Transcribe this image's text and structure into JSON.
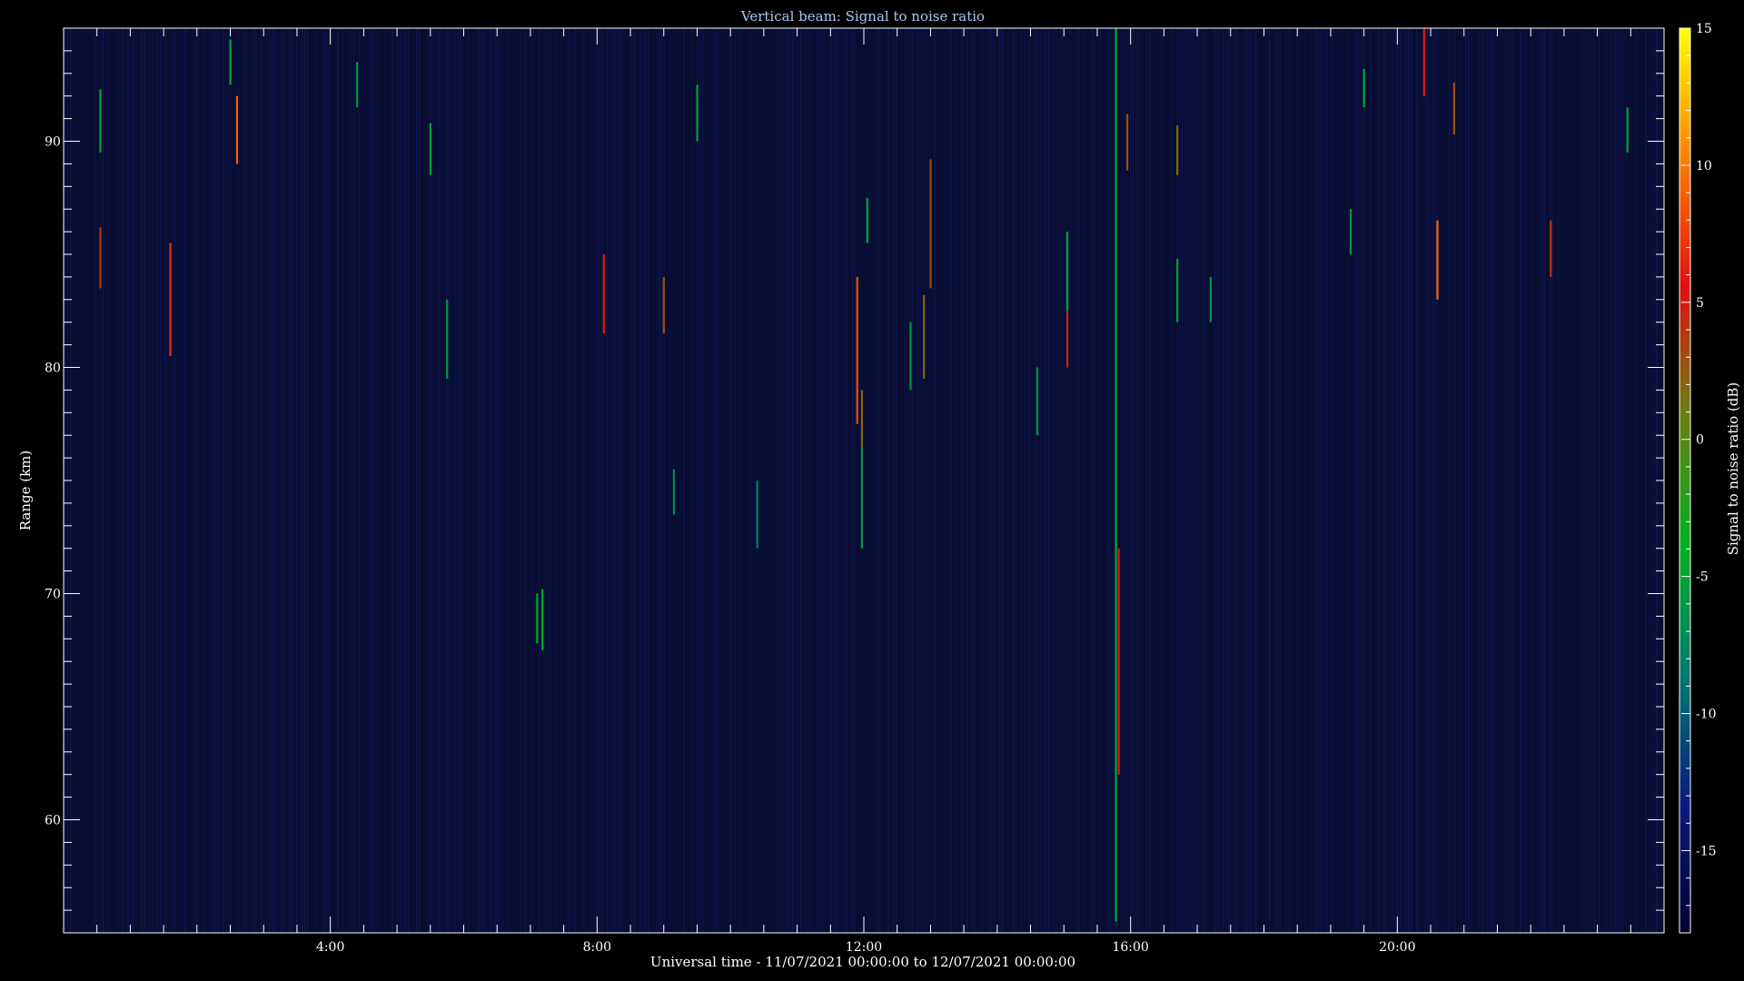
{
  "chart_data": {
    "type": "heatmap",
    "title": "Vertical beam: Signal to noise ratio",
    "xlabel": "Universal time - 11/07/2021 00:00:00 to 12/07/2021 00:00:00",
    "ylabel": "Range (km)",
    "colorbar_label": "Signal to noise ratio (dB)",
    "x_unit": "hours",
    "xlim": [
      0,
      24
    ],
    "ylim": [
      55,
      95
    ],
    "x_ticks": [
      {
        "value": 4,
        "label": "4:00"
      },
      {
        "value": 8,
        "label": "8:00"
      },
      {
        "value": 12,
        "label": "12:00"
      },
      {
        "value": 16,
        "label": "16:00"
      },
      {
        "value": 20,
        "label": "20:00"
      }
    ],
    "y_ticks": [
      {
        "value": 60,
        "label": "60"
      },
      {
        "value": 70,
        "label": "70"
      },
      {
        "value": 80,
        "label": "80"
      },
      {
        "value": 90,
        "label": "90"
      }
    ],
    "colorbar_range": [
      -18,
      15
    ],
    "colorbar_ticks": [
      {
        "value": 15,
        "label": "15"
      },
      {
        "value": 10,
        "label": "10"
      },
      {
        "value": 5,
        "label": "5"
      },
      {
        "value": 0,
        "label": "0"
      },
      {
        "value": -5,
        "label": "-5"
      },
      {
        "value": -10,
        "label": "-10"
      },
      {
        "value": -15,
        "label": "-15"
      }
    ],
    "colormap": [
      "#000030",
      "#0a1a80",
      "#007a70",
      "#00b020",
      "#6a8010",
      "#e01010",
      "#ff8000",
      "#ffff00"
    ],
    "background_color": "#080c30",
    "echoes": [
      {
        "t": 0.55,
        "r0": 83.5,
        "r1": 86.2,
        "snr": 4
      },
      {
        "t": 0.55,
        "r0": 89.5,
        "r1": 92.3,
        "snr": -5
      },
      {
        "t": 1.6,
        "r0": 80.5,
        "r1": 85.5,
        "snr": 7
      },
      {
        "t": 2.5,
        "r0": 92.5,
        "r1": 94.5,
        "snr": -5
      },
      {
        "t": 2.6,
        "r0": 89.0,
        "r1": 92.0,
        "snr": 9
      },
      {
        "t": 4.4,
        "r0": 91.5,
        "r1": 93.5,
        "snr": -6
      },
      {
        "t": 5.5,
        "r0": 88.5,
        "r1": 90.8,
        "snr": -5
      },
      {
        "t": 5.75,
        "r0": 79.5,
        "r1": 83.0,
        "snr": -6
      },
      {
        "t": 7.1,
        "r0": 67.8,
        "r1": 70.0,
        "snr": -4
      },
      {
        "t": 7.18,
        "r0": 67.5,
        "r1": 70.2,
        "snr": -4
      },
      {
        "t": 8.1,
        "r0": 81.5,
        "r1": 85.0,
        "snr": 5
      },
      {
        "t": 9.0,
        "r0": 81.5,
        "r1": 84.0,
        "snr": 3
      },
      {
        "t": 9.5,
        "r0": 90.0,
        "r1": 92.5,
        "snr": -5
      },
      {
        "t": 9.15,
        "r0": 73.5,
        "r1": 75.5,
        "snr": -7
      },
      {
        "t": 10.4,
        "r0": 72.0,
        "r1": 75.0,
        "snr": -8
      },
      {
        "t": 11.9,
        "r0": 77.5,
        "r1": 84.0,
        "snr": 8
      },
      {
        "t": 11.97,
        "r0": 76.5,
        "r1": 79.0,
        "snr": 2
      },
      {
        "t": 11.97,
        "r0": 72.0,
        "r1": 76.5,
        "snr": -6
      },
      {
        "t": 12.05,
        "r0": 85.5,
        "r1": 87.5,
        "snr": -5
      },
      {
        "t": 12.7,
        "r0": 79.0,
        "r1": 82.0,
        "snr": -6
      },
      {
        "t": 12.9,
        "r0": 79.5,
        "r1": 83.2,
        "snr": 2
      },
      {
        "t": 13.0,
        "r0": 83.5,
        "r1": 89.2,
        "snr": 3
      },
      {
        "t": 14.6,
        "r0": 77.0,
        "r1": 80.0,
        "snr": -6
      },
      {
        "t": 15.05,
        "r0": 80.0,
        "r1": 82.5,
        "snr": 5
      },
      {
        "t": 15.05,
        "r0": 82.5,
        "r1": 86.0,
        "snr": -5
      },
      {
        "t": 15.78,
        "r0": 55.5,
        "r1": 95.0,
        "snr": -5
      },
      {
        "t": 15.82,
        "r0": 62.0,
        "r1": 72.0,
        "snr": 6
      },
      {
        "t": 15.95,
        "r0": 88.7,
        "r1": 91.2,
        "snr": 3
      },
      {
        "t": 16.7,
        "r0": 88.5,
        "r1": 90.7,
        "snr": 2
      },
      {
        "t": 16.7,
        "r0": 82.0,
        "r1": 84.8,
        "snr": -5
      },
      {
        "t": 17.2,
        "r0": 82.0,
        "r1": 84.0,
        "snr": -6
      },
      {
        "t": 19.3,
        "r0": 85.0,
        "r1": 87.0,
        "snr": -6
      },
      {
        "t": 19.5,
        "r0": 91.5,
        "r1": 93.2,
        "snr": -5
      },
      {
        "t": 20.4,
        "r0": 92.0,
        "r1": 95.0,
        "snr": 6
      },
      {
        "t": 20.6,
        "r0": 83.0,
        "r1": 86.5,
        "snr": 9
      },
      {
        "t": 20.85,
        "r0": 90.3,
        "r1": 92.6,
        "snr": 3
      },
      {
        "t": 22.3,
        "r0": 84.0,
        "r1": 86.5,
        "snr": 4
      },
      {
        "t": 23.45,
        "r0": 89.5,
        "r1": 91.5,
        "snr": -5
      }
    ]
  }
}
